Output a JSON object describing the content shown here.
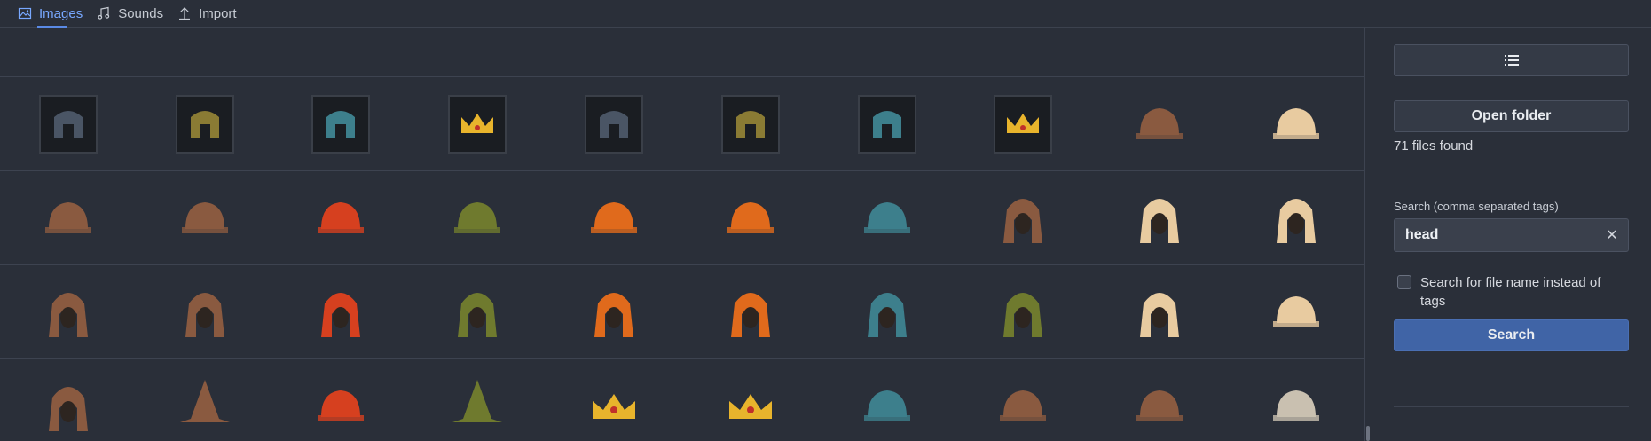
{
  "tabs": [
    {
      "label": "Images",
      "icon": "image-icon",
      "active": true
    },
    {
      "label": "Sounds",
      "icon": "music-note-icon",
      "active": false
    },
    {
      "label": "Import",
      "icon": "upload-icon",
      "active": false
    }
  ],
  "gallery": {
    "rows": [
      [
        "helmet-dark-framed",
        "helmet-gold-framed",
        "helmet-teal-framed",
        "crown-gold-framed",
        "helmet-dark-framed",
        "helmet-gold-framed",
        "helmet-teal-framed",
        "crown-gold-framed",
        "fur-cap-brown",
        "fur-cap-cream"
      ],
      [
        "brown-hat",
        "feather-hat",
        "red-beret",
        "green-feather-hat",
        "jester-cap",
        "orange-cap",
        "teal-feather-cap",
        "bear-hood",
        "chicken-hood",
        "cream-hood"
      ],
      [
        "brown-hood-tall",
        "brown-hood-wide",
        "red-hood",
        "green-hood",
        "jester-hood",
        "brown-hood-orange",
        "teal-hood",
        "goblin-hood",
        "cream-hood-belt",
        "cream-helmet"
      ],
      [
        "brown-hood-laced",
        "wizard-hat",
        "red-lion-mane",
        "green-cone-hat",
        "gold-crown-small",
        "gold-crown-jeweled",
        "teal-cap",
        "horned-helm",
        "bald-cap",
        "metal-cap"
      ]
    ]
  },
  "panel": {
    "list_button_icon": "list-icon",
    "open_folder": "Open folder",
    "files_found": "71 files found",
    "search_label": "Search (comma separated tags)",
    "search_value": "head",
    "clear_icon": "close-icon",
    "filename_checkbox_label": "Search for file name instead of tags",
    "search_button": "Search"
  },
  "colors": {
    "background": "#2a2f39",
    "accent": "#5a8ae6",
    "primary_button": "#4064a6"
  }
}
